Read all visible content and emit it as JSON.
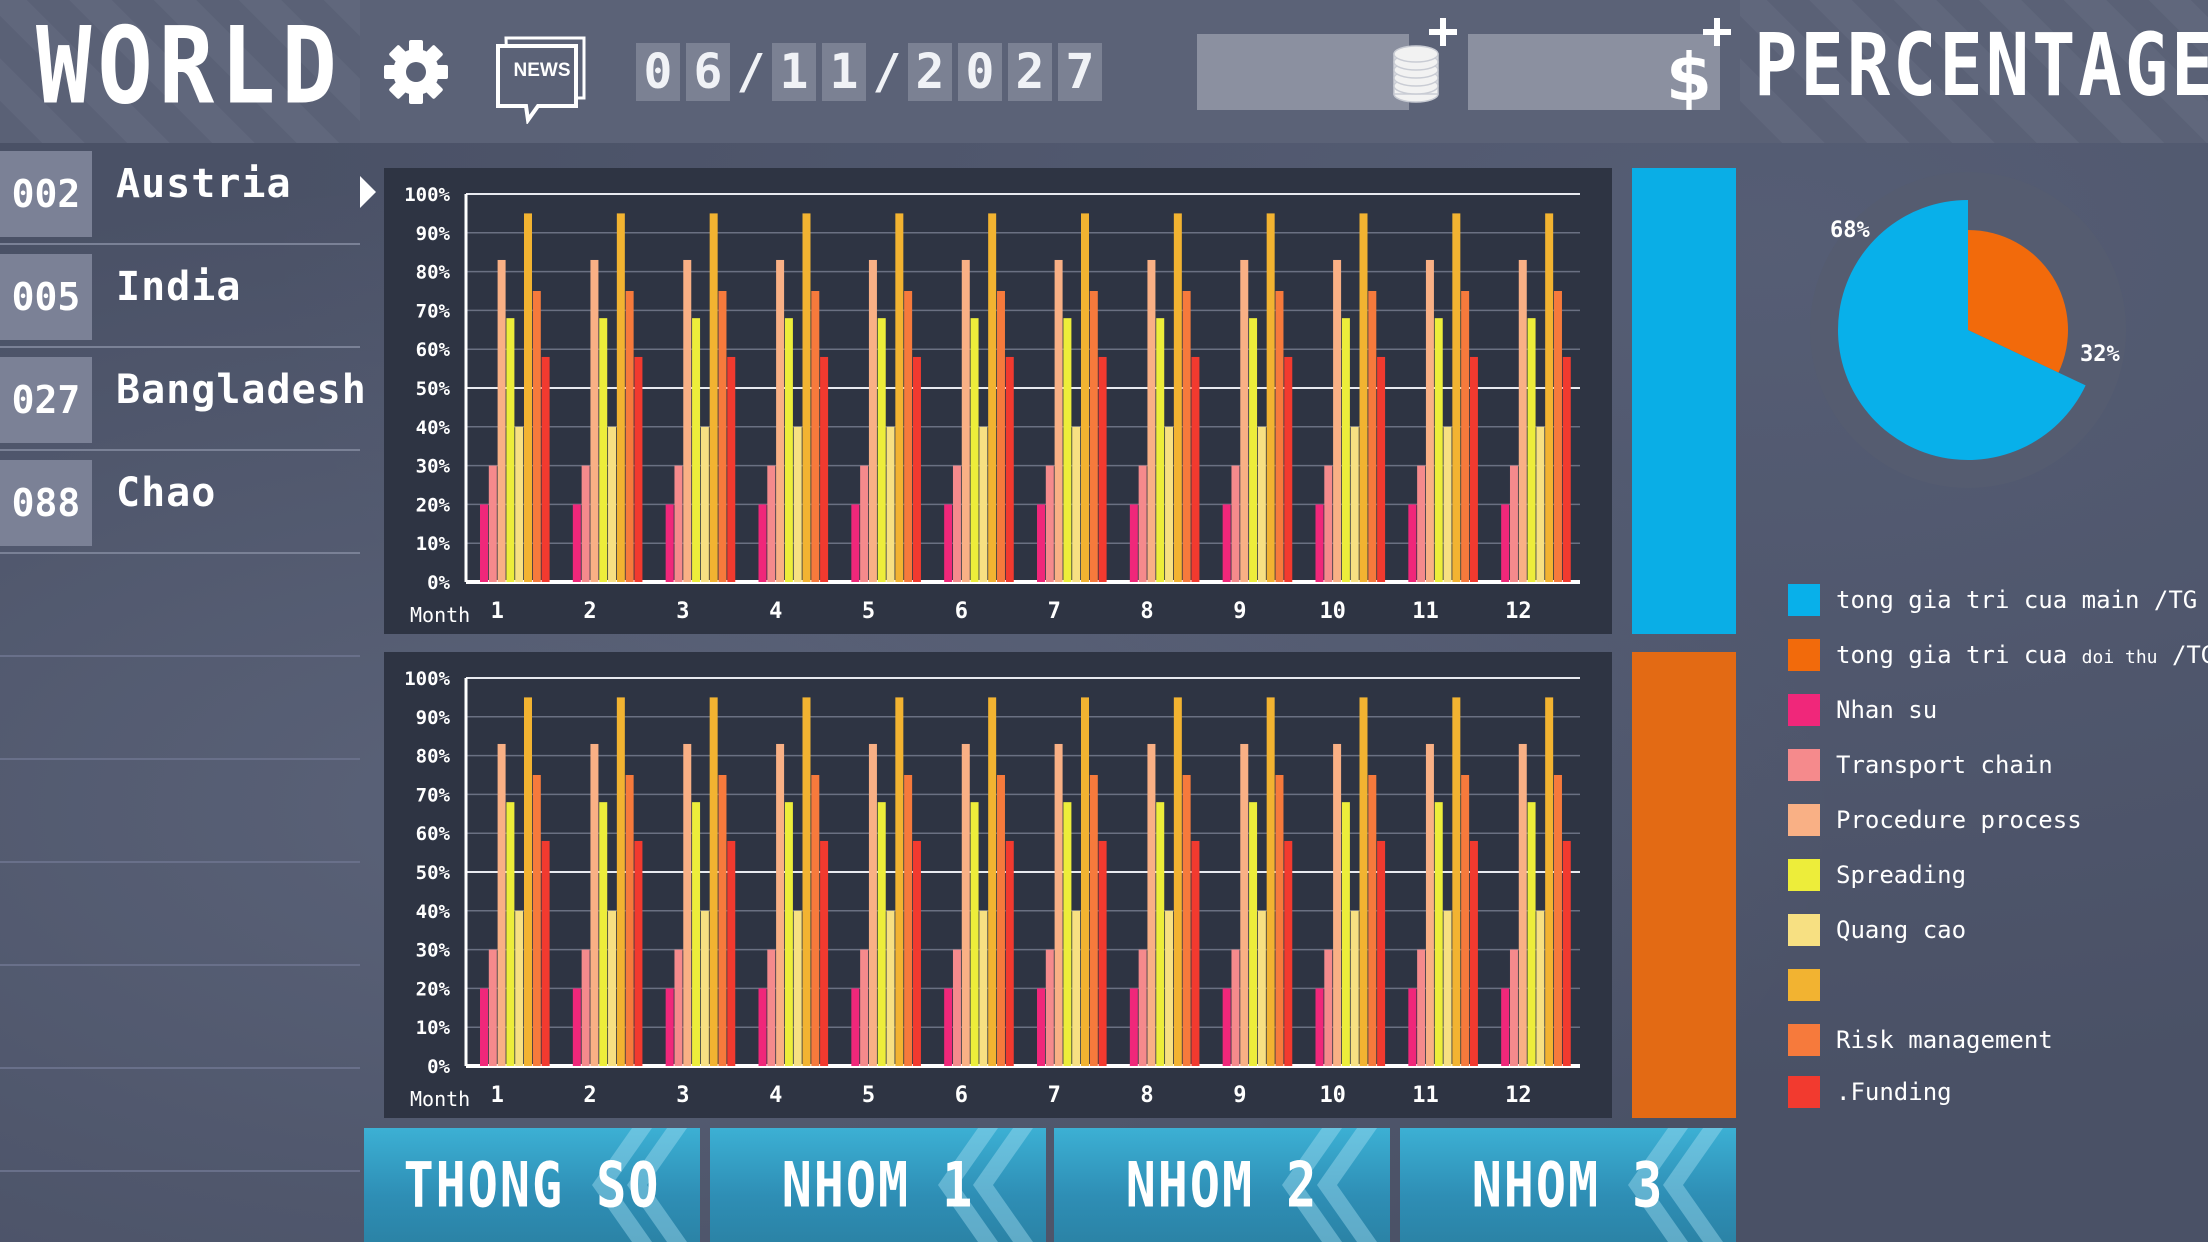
{
  "header": {
    "world_title": "WORLD",
    "percentage_title": "PERCENTAGE",
    "news_label": "NEWS",
    "date_digits": [
      "0",
      "6",
      "/",
      "1",
      "1",
      "/",
      "2",
      "0",
      "2",
      "7"
    ],
    "icons": [
      "gear-icon",
      "news-icon",
      "coins-icon",
      "dollar-icon",
      "plus-icon"
    ]
  },
  "sidebar": {
    "countries": [
      {
        "code": "002",
        "name": "Austria"
      },
      {
        "code": "005",
        "name": "India"
      },
      {
        "code": "027",
        "name": "Bangladesh"
      },
      {
        "code": "088",
        "name": "Chao"
      }
    ]
  },
  "tabs": [
    {
      "label": "THONG SO"
    },
    {
      "label": "NHOM 1"
    },
    {
      "label": "NHOM 2"
    },
    {
      "label": "NHOM 3"
    }
  ],
  "legend": [
    {
      "label": "tong gia tri cua main /TG",
      "color": "#08b0ea"
    },
    {
      "label": "tong gia tri cua",
      "small": "doi thu",
      "label_end": "/TG",
      "color": "#f26a0b"
    },
    {
      "label": "Nhan su",
      "color": "#f0277a"
    },
    {
      "label": "Transport chain",
      "color": "#f58a8c"
    },
    {
      "label": "Procedure process",
      "color": "#f9b085"
    },
    {
      "label": "Spreading",
      "color": "#eded3a"
    },
    {
      "label": "Quang cao",
      "color": "#f7e082"
    },
    {
      "label": "",
      "color": "#f2b331"
    },
    {
      "label": "Risk management",
      "color": "#f67a3c"
    },
    {
      "label": ".Funding",
      "color": "#f23a2f"
    }
  ],
  "chart_data": [
    {
      "type": "bar",
      "xlabel": "Month",
      "categories": [
        "1",
        "2",
        "3",
        "4",
        "5",
        "6",
        "7",
        "8",
        "9",
        "10",
        "11",
        "12"
      ],
      "ytick_labels": [
        "100%",
        "90%",
        "80%",
        "70%",
        "60%",
        "50%",
        "40%",
        "30%",
        "20%",
        "10%",
        "0%"
      ],
      "ylim": [
        0,
        100
      ],
      "series": [
        {
          "name": "Nhan su",
          "color": "#f0277a",
          "values": [
            20,
            20,
            20,
            20,
            20,
            20,
            20,
            20,
            20,
            20,
            20,
            20
          ]
        },
        {
          "name": "Transport chain",
          "color": "#f58a8c",
          "values": [
            30,
            30,
            30,
            30,
            30,
            30,
            30,
            30,
            30,
            30,
            30,
            30
          ]
        },
        {
          "name": "Procedure process",
          "color": "#f9b085",
          "values": [
            83,
            83,
            83,
            83,
            83,
            83,
            83,
            83,
            83,
            83,
            83,
            83
          ]
        },
        {
          "name": "Spreading",
          "color": "#eded3a",
          "values": [
            68,
            68,
            68,
            68,
            68,
            68,
            68,
            68,
            68,
            68,
            68,
            68
          ]
        },
        {
          "name": "Quang cao",
          "color": "#f7e082",
          "values": [
            40,
            40,
            40,
            40,
            40,
            40,
            40,
            40,
            40,
            40,
            40,
            40
          ]
        },
        {
          "name": "",
          "color": "#f2b331",
          "values": [
            95,
            95,
            95,
            95,
            95,
            95,
            95,
            95,
            95,
            95,
            95,
            95
          ]
        },
        {
          "name": "Risk management",
          "color": "#f67a3c",
          "values": [
            75,
            75,
            75,
            75,
            75,
            75,
            75,
            75,
            75,
            75,
            75,
            75
          ]
        },
        {
          "name": ".Funding",
          "color": "#f23a2f",
          "values": [
            58,
            58,
            58,
            58,
            58,
            58,
            58,
            58,
            58,
            58,
            58,
            58
          ]
        }
      ]
    },
    {
      "type": "bar",
      "xlabel": "Month",
      "categories": [
        "1",
        "2",
        "3",
        "4",
        "5",
        "6",
        "7",
        "8",
        "9",
        "10",
        "11",
        "12"
      ],
      "ytick_labels": [
        "100%",
        "90%",
        "80%",
        "70%",
        "60%",
        "50%",
        "40%",
        "30%",
        "20%",
        "10%",
        "0%"
      ],
      "ylim": [
        0,
        100
      ],
      "series": [
        {
          "name": "Nhan su",
          "color": "#f0277a",
          "values": [
            20,
            20,
            20,
            20,
            20,
            20,
            20,
            20,
            20,
            20,
            20,
            20
          ]
        },
        {
          "name": "Transport chain",
          "color": "#f58a8c",
          "values": [
            30,
            30,
            30,
            30,
            30,
            30,
            30,
            30,
            30,
            30,
            30,
            30
          ]
        },
        {
          "name": "Procedure process",
          "color": "#f9b085",
          "values": [
            83,
            83,
            83,
            83,
            83,
            83,
            83,
            83,
            83,
            83,
            83,
            83
          ]
        },
        {
          "name": "Spreading",
          "color": "#eded3a",
          "values": [
            68,
            68,
            68,
            68,
            68,
            68,
            68,
            68,
            68,
            68,
            68,
            68
          ]
        },
        {
          "name": "Quang cao",
          "color": "#f7e082",
          "values": [
            40,
            40,
            40,
            40,
            40,
            40,
            40,
            40,
            40,
            40,
            40,
            40
          ]
        },
        {
          "name": "",
          "color": "#f2b331",
          "values": [
            95,
            95,
            95,
            95,
            95,
            95,
            95,
            95,
            95,
            95,
            95,
            95
          ]
        },
        {
          "name": "Risk management",
          "color": "#f67a3c",
          "values": [
            75,
            75,
            75,
            75,
            75,
            75,
            75,
            75,
            75,
            75,
            75,
            75
          ]
        },
        {
          "name": ".Funding",
          "color": "#f23a2f",
          "values": [
            58,
            58,
            58,
            58,
            58,
            58,
            58,
            58,
            58,
            58,
            58,
            58
          ]
        }
      ]
    },
    {
      "type": "pie",
      "slices": [
        {
          "label": "68%",
          "value": 68,
          "color": "#08b0ea"
        },
        {
          "label": "32%",
          "value": 32,
          "color": "#f26a0b"
        }
      ]
    }
  ]
}
